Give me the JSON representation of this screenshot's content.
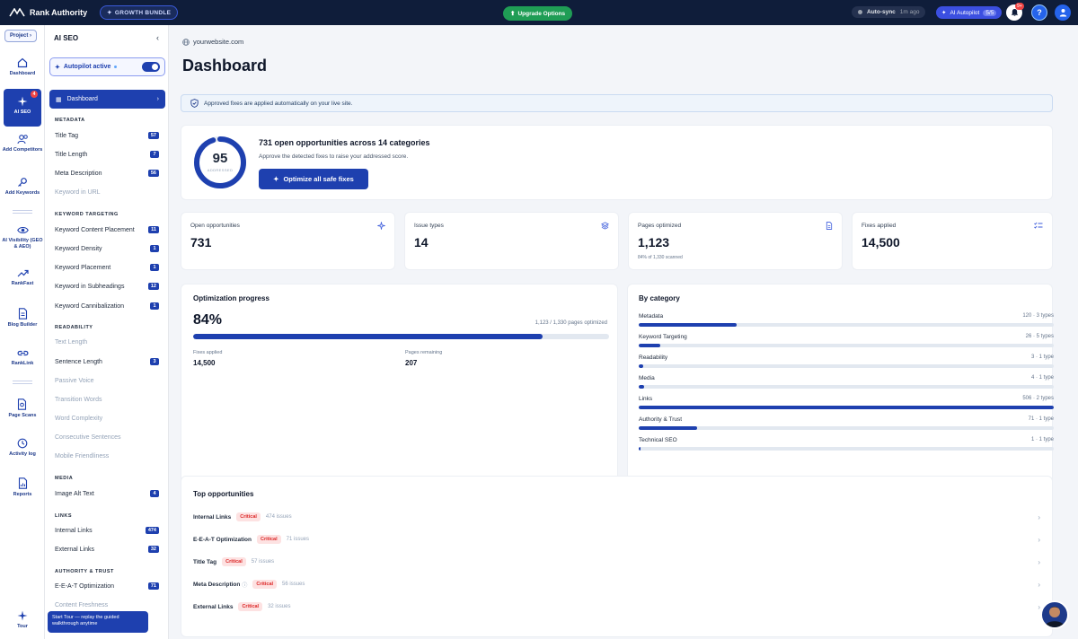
{
  "topbar": {
    "brand": "Rank Authority",
    "bundle": "GROWTH BUNDLE",
    "upgrade": "Upgrade Options",
    "autosync": "Auto-sync",
    "autosync_time": "1m ago",
    "ai_autopilot": "AI Autopilot",
    "ai_autopilot_count": "5/5",
    "notif_count": "9+",
    "help": "?"
  },
  "rail": {
    "project": "Project",
    "items": [
      {
        "label": "Dashboard",
        "icon": "home-icon"
      },
      {
        "label": "AI SEO",
        "icon": "sparkle-icon",
        "badge": "4"
      },
      {
        "label": "Add Competitors",
        "icon": "users-icon"
      },
      {
        "label": "Add Keywords",
        "icon": "key-icon"
      },
      {
        "label": "AI Visibility (GEO & AEO)",
        "icon": "eye-icon"
      },
      {
        "label": "RankFast",
        "icon": "trend-icon"
      },
      {
        "label": "Blog Builder",
        "icon": "document-icon"
      },
      {
        "label": "RankLink",
        "icon": "link-icon"
      },
      {
        "label": "Page Scans",
        "icon": "page-scan-icon"
      },
      {
        "label": "Activity log",
        "icon": "history-icon"
      },
      {
        "label": "Reports",
        "icon": "report-icon"
      },
      {
        "label": "Tour",
        "icon": "tour-icon"
      }
    ]
  },
  "sidebar": {
    "title": "AI SEO",
    "autopilot": "Autopilot active",
    "dashboard": "Dashboard",
    "sections": {
      "metadata": "METADATA",
      "keyword": "KEYWORD TARGETING",
      "readability": "READABILITY",
      "media": "MEDIA",
      "links": "LINKS",
      "authority": "AUTHORITY & TRUST"
    },
    "items": [
      {
        "label": "Title Tag",
        "badge": "57"
      },
      {
        "label": "Title Length",
        "badge": "7"
      },
      {
        "label": "Meta Description",
        "badge": "56"
      },
      {
        "label": "Keyword in URL"
      },
      {
        "label": "Keyword Content Placement",
        "badge": "11"
      },
      {
        "label": "Keyword Density",
        "badge": "1"
      },
      {
        "label": "Keyword Placement",
        "badge": "1"
      },
      {
        "label": "Keyword in Subheadings",
        "badge": "12"
      },
      {
        "label": "Keyword Cannibalization",
        "badge": "1"
      },
      {
        "label": "Text Length"
      },
      {
        "label": "Sentence Length",
        "badge": "3"
      },
      {
        "label": "Passive Voice"
      },
      {
        "label": "Transition Words"
      },
      {
        "label": "Word Complexity"
      },
      {
        "label": "Consecutive Sentences"
      },
      {
        "label": "Mobile Friendliness"
      },
      {
        "label": "Image Alt Text",
        "badge": "4"
      },
      {
        "label": "Internal Links",
        "badge": "474"
      },
      {
        "label": "External Links",
        "badge": "32"
      },
      {
        "label": "E-E-A-T Optimization",
        "badge": "71"
      },
      {
        "label": "Content Freshness"
      }
    ],
    "tour_tip": "Start Tour — replay the guided walkthrough anytime"
  },
  "main": {
    "site": "yourwebsite.com",
    "title": "Dashboard",
    "notice": "Approved fixes are applied automatically on your live site.",
    "hero": {
      "score": "95",
      "score_label": "ADDRESSED",
      "score_value": 0.95,
      "headline": "731 open opportunities across 14 categories",
      "sub": "Approve the detected fixes to raise your addressed score.",
      "button": "Optimize all safe fixes"
    },
    "stats": [
      {
        "label": "Open opportunities",
        "value": "731",
        "icon": "sparkle-icon"
      },
      {
        "label": "Issue types",
        "value": "14",
        "icon": "layers-icon"
      },
      {
        "label": "Pages optimized",
        "value": "1,123",
        "sub": "84% of 1,330 scanned",
        "icon": "file-icon"
      },
      {
        "label": "Fixes applied",
        "value": "14,500",
        "icon": "checklist-icon"
      }
    ],
    "progress": {
      "title": "Optimization progress",
      "pct": "84%",
      "value": 0.84,
      "right": "1,123 / 1,330 pages optimized",
      "fixes_label": "Fixes applied",
      "fixes_value": "14,500",
      "remaining_label": "Pages remaining",
      "remaining_value": "207"
    },
    "categories": {
      "title": "By category",
      "rows": [
        {
          "name": "Metadata",
          "count": "120 · 3 types",
          "value": 0.237
        },
        {
          "name": "Keyword Targeting",
          "count": "26 · 5 types",
          "value": 0.051
        },
        {
          "name": "Readability",
          "count": "3 · 1 type",
          "value": 0.01
        },
        {
          "name": "Media",
          "count": "4 · 1 type",
          "value": 0.012
        },
        {
          "name": "Links",
          "count": "506 · 2 types",
          "value": 1.0
        },
        {
          "name": "Authority & Trust",
          "count": "71 · 1 type",
          "value": 0.14
        },
        {
          "name": "Technical SEO",
          "count": "1 · 1 type",
          "value": 0.004
        }
      ]
    },
    "top": {
      "title": "Top opportunities",
      "rows": [
        {
          "name": "Internal Links",
          "tag": "Critical",
          "issues": "474 issues"
        },
        {
          "name": "E-E-A-T Optimization",
          "tag": "Critical",
          "issues": "71 issues"
        },
        {
          "name": "Title Tag",
          "tag": "Critical",
          "issues": "57 issues"
        },
        {
          "name": "Meta Description",
          "tag": "Critical",
          "issues": "56 issues"
        },
        {
          "name": "External Links",
          "tag": "Critical",
          "issues": "32 issues"
        }
      ]
    }
  }
}
